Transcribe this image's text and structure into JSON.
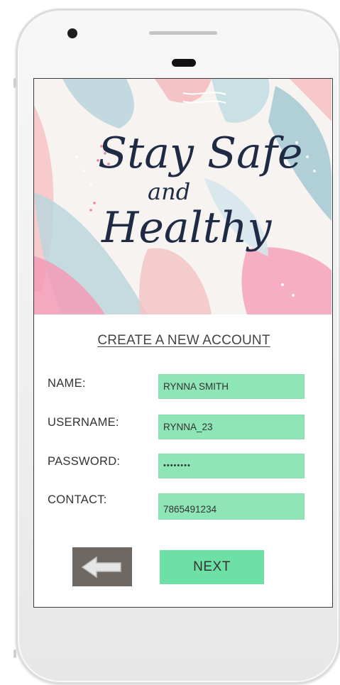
{
  "banner": {
    "line1": "Stay Safe",
    "line2": "and",
    "line3": "Healthy"
  },
  "form": {
    "title": "CREATE A NEW ACCOUNT",
    "fields": [
      {
        "label": "NAME:",
        "value": "RYNNA SMITH"
      },
      {
        "label": "USERNAME:",
        "value": "RYNNA_23"
      },
      {
        "label": "PASSWORD:",
        "value": "••••••••"
      },
      {
        "label": "CONTACT:",
        "value": "7865491234"
      }
    ]
  },
  "buttons": {
    "back_icon": "left-arrow-icon",
    "next_label": "NEXT"
  },
  "colors": {
    "input_bg": "#8ee5b5",
    "next_bg": "#6de0a6",
    "back_bg": "#6f6761",
    "script_text": "#1f2b45"
  }
}
